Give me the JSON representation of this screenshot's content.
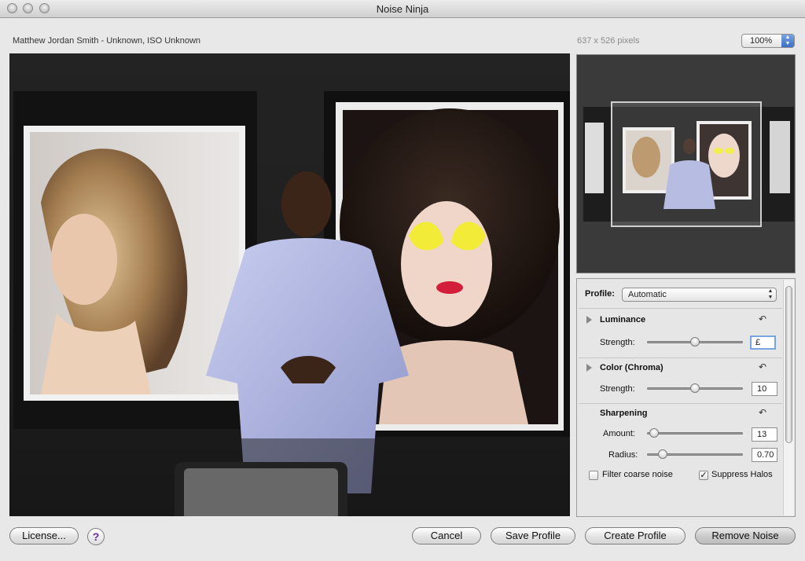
{
  "window": {
    "title": "Noise Ninja"
  },
  "info": {
    "camera_info": "Matthew Jordan Smith - Unknown, ISO Unknown",
    "image_size": "637 x 526 pixels",
    "zoom": "100%"
  },
  "panel": {
    "profile_label": "Profile:",
    "profile_value": "Automatic",
    "luminance": {
      "title": "Luminance",
      "strength_label": "Strength:",
      "strength_value": "£",
      "strength_slider": 0.5
    },
    "color": {
      "title": "Color (Chroma)",
      "strength_label": "Strength:",
      "strength_value": "10",
      "strength_slider": 0.5
    },
    "sharpening": {
      "title": "Sharpening",
      "amount_label": "Amount:",
      "amount_value": "13",
      "amount_slider": 0.07,
      "radius_label": "Radius:",
      "radius_value": "0.70",
      "radius_slider": 0.16
    },
    "filter_coarse_label": "Filter coarse noise",
    "filter_coarse_checked": false,
    "suppress_halos_label": "Suppress Halos",
    "suppress_halos_checked": true
  },
  "buttons": {
    "license": "License...",
    "help": "?",
    "cancel": "Cancel",
    "save_profile": "Save Profile",
    "create_profile": "Create Profile",
    "remove_noise": "Remove Noise"
  },
  "icons": {
    "reset": "reset-arrow-icon",
    "disclosure": "disclosure-triangle-icon",
    "check": "checkmark-icon"
  }
}
